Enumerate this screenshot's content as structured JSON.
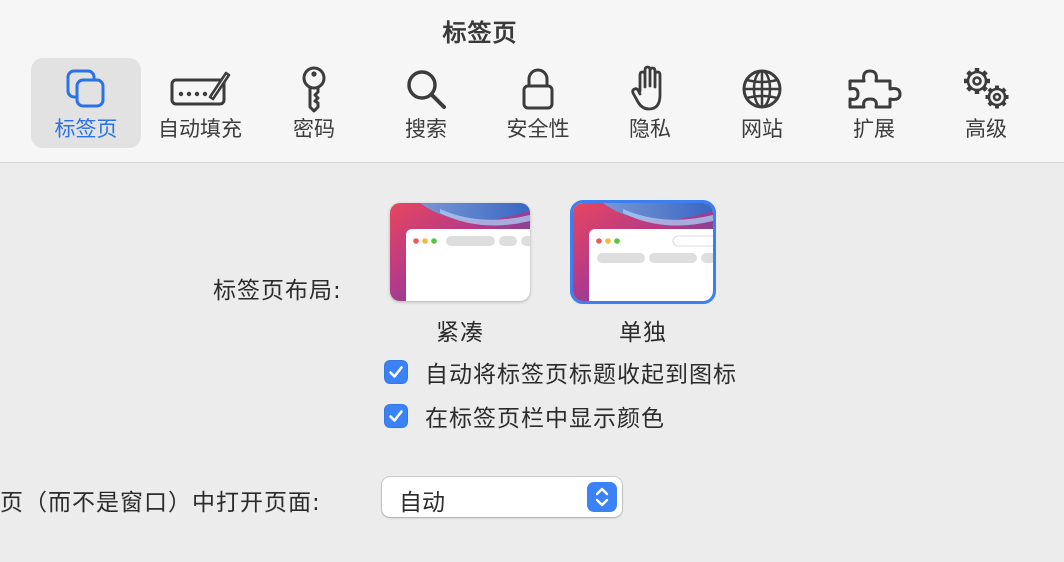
{
  "window": {
    "title": "标签页"
  },
  "toolbar": {
    "tabs": [
      {
        "label": "标签页",
        "icon": "tabs-icon",
        "selected": true
      },
      {
        "label": "自动填充",
        "icon": "autofill-icon",
        "selected": false
      },
      {
        "label": "密码",
        "icon": "key-icon",
        "selected": false
      },
      {
        "label": "搜索",
        "icon": "search-icon",
        "selected": false
      },
      {
        "label": "安全性",
        "icon": "lock-icon",
        "selected": false
      },
      {
        "label": "隐私",
        "icon": "hand-icon",
        "selected": false
      },
      {
        "label": "网站",
        "icon": "globe-icon",
        "selected": false
      },
      {
        "label": "扩展",
        "icon": "puzzle-icon",
        "selected": false
      },
      {
        "label": "高级",
        "icon": "gears-icon",
        "selected": false
      }
    ]
  },
  "tab_layout": {
    "label": "标签页布局:",
    "options": [
      {
        "caption": "紧凑",
        "selected": false
      },
      {
        "caption": "单独",
        "selected": true
      }
    ]
  },
  "checkboxes": [
    {
      "label": "自动将标签页标题收起到图标",
      "checked": true
    },
    {
      "label": "在标签页栏中显示颜色",
      "checked": true
    }
  ],
  "open_pages": {
    "label": "页（而不是窗口）中打开页面:",
    "value": "自动"
  },
  "colors": {
    "accent": "#3b82f6",
    "selected_tab_text": "#2a72e5"
  }
}
